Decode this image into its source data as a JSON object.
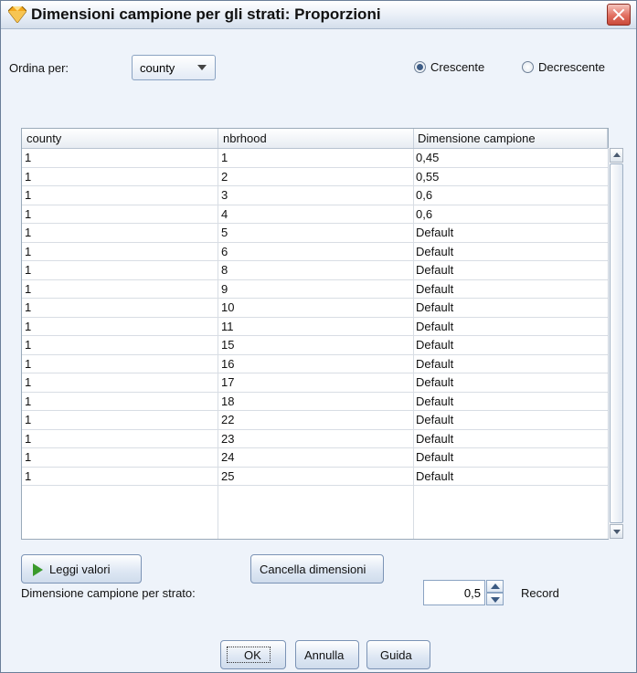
{
  "window": {
    "title": "Dimensioni campione per gli strati: Proporzioni"
  },
  "sort": {
    "label": "Ordina per:",
    "selected": "county",
    "ascending_label": "Crescente",
    "descending_label": "Decrescente",
    "ascending_checked": true
  },
  "table": {
    "headers": [
      "county",
      "nbrhood",
      "Dimensione campione"
    ],
    "rows": [
      [
        "1",
        "1",
        "0,45"
      ],
      [
        "1",
        "2",
        "0,55"
      ],
      [
        "1",
        "3",
        "0,6"
      ],
      [
        "1",
        "4",
        "0,6"
      ],
      [
        "1",
        "5",
        "Default"
      ],
      [
        "1",
        "6",
        "Default"
      ],
      [
        "1",
        "8",
        "Default"
      ],
      [
        "1",
        "9",
        "Default"
      ],
      [
        "1",
        "10",
        "Default"
      ],
      [
        "1",
        "11",
        "Default"
      ],
      [
        "1",
        "15",
        "Default"
      ],
      [
        "1",
        "16",
        "Default"
      ],
      [
        "1",
        "17",
        "Default"
      ],
      [
        "1",
        "18",
        "Default"
      ],
      [
        "1",
        "22",
        "Default"
      ],
      [
        "1",
        "23",
        "Default"
      ],
      [
        "1",
        "24",
        "Default"
      ],
      [
        "1",
        "25",
        "Default"
      ]
    ]
  },
  "buttons": {
    "read_values": "Leggi valori",
    "clear_sizes": "Cancella dimensioni",
    "ok": "OK",
    "cancel": "Annulla",
    "help": "Guida"
  },
  "sample_size": {
    "label": "Dimensione campione per strato:",
    "value": "0,5",
    "unit": "Record"
  },
  "icons": {
    "app": "diamond-app-icon",
    "close": "close-icon",
    "play": "play-icon"
  },
  "colors": {
    "accent_green": "#3a9a2c",
    "title_close": "#e26f60",
    "diamond_orange": "#f3a81c"
  }
}
